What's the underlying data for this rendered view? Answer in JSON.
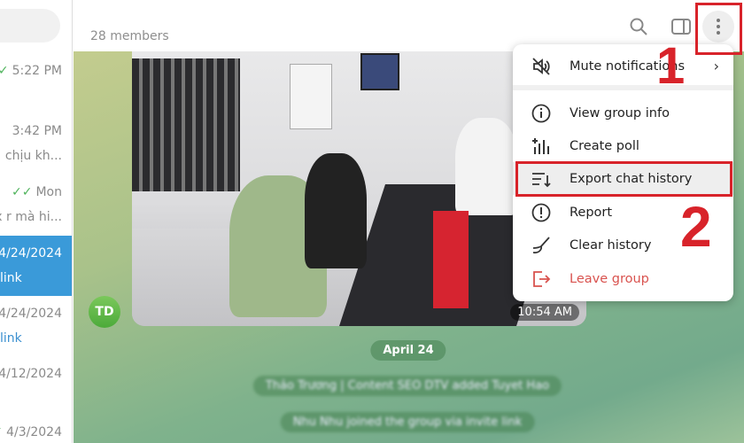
{
  "sidebar": {
    "items": [
      {
        "time": "5:22 PM",
        "read": true,
        "sub": ""
      },
      {
        "time": "3:42 PM",
        "sub": "chịu kh..."
      },
      {
        "time": "Mon",
        "read": true,
        "sub": "x r mà hi..."
      },
      {
        "time": "4/24/2024",
        "sub": "link",
        "selected": true
      },
      {
        "time": "4/24/2024",
        "sub": "link"
      },
      {
        "time": "4/12/2024",
        "sub": ""
      },
      {
        "time": "4/3/2024",
        "read": true,
        "sub": ""
      }
    ]
  },
  "header": {
    "members": "28 members",
    "icons": [
      "search-icon",
      "sidebar-toggle-icon",
      "more-vertical-icon"
    ]
  },
  "chat": {
    "photo_time": "10:54 AM",
    "avatar_initials": "TD",
    "date_pill": "April 24",
    "service_messages": [
      "Thảo Trương | Content SEO DTV added Tuyet Hao",
      "Nhu Nhu joined the group via invite link"
    ]
  },
  "menu": {
    "items": [
      {
        "label": "Mute notifications",
        "icon": "mute-icon"
      },
      {
        "label": "View group info",
        "icon": "info-icon"
      },
      {
        "label": "Create poll",
        "icon": "poll-icon"
      },
      {
        "label": "Export chat history",
        "icon": "export-icon"
      },
      {
        "label": "Report",
        "icon": "report-icon"
      },
      {
        "label": "Clear history",
        "icon": "broom-icon"
      },
      {
        "label": "Leave group",
        "icon": "leave-icon"
      }
    ]
  },
  "annotations": {
    "step1": "1",
    "step2": "2",
    "color": "#d8232a"
  },
  "colors": {
    "selected": "#3a9ad9",
    "danger": "#d9534f"
  }
}
